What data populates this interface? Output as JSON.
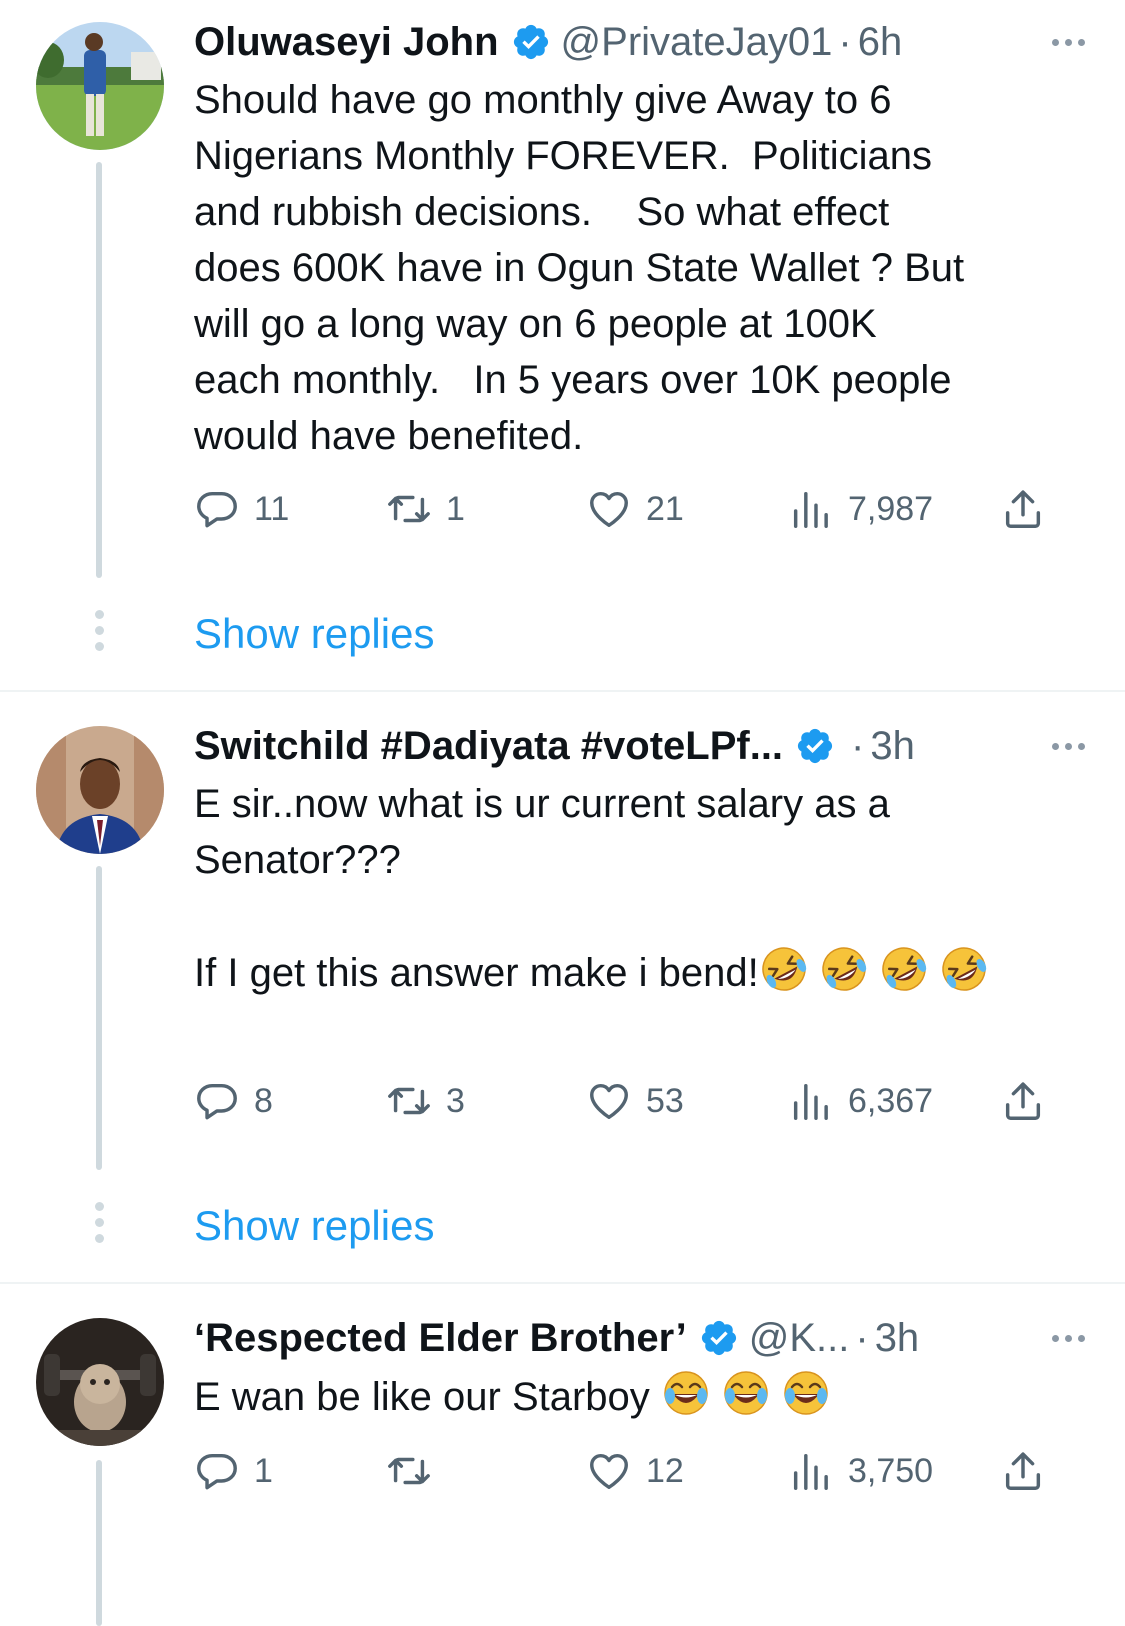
{
  "tweets": [
    {
      "name": "Oluwaseyi John",
      "handle": "@PrivateJay01",
      "dot": "·",
      "time": "6h",
      "text": "Should have go monthly give Away to 6\nNigerians Monthly FOREVER.  Politicians\nand rubbish decisions.    So what effect\ndoes 600K have in Ogun State Wallet ? But\nwill go a long way on 6 people at 100K\neach monthly.   In 5 years over 10K people\nwould have benefited.",
      "replies": "11",
      "retweets": "1",
      "likes": "21",
      "views": "7,987",
      "show_replies": "Show replies"
    },
    {
      "name": "Switchild #Dadiyata #voteLPf...",
      "handle": "",
      "dot": "·",
      "time": "3h",
      "text": "E sir..now what is ur current salary as a\nSenator???\n\nIf I get this answer make i bend!",
      "emoji_trailing": [
        "rolling-on-floor-laughing",
        "rolling-on-floor-laughing",
        "rolling-on-floor-laughing",
        "rolling-on-floor-laughing"
      ],
      "replies": "8",
      "retweets": "3",
      "likes": "53",
      "views": "6,367",
      "show_replies": "Show replies"
    },
    {
      "name": "‘Respected Elder Brother’",
      "handle": "@K...",
      "dot": "·",
      "time": "3h",
      "text": "E wan be like our Starboy ",
      "emoji_trailing": [
        "face-with-tears-of-joy",
        "face-with-tears-of-joy",
        "face-with-tears-of-joy"
      ],
      "replies": "1",
      "retweets": "",
      "likes": "12",
      "views": "3,750"
    }
  ],
  "colors": {
    "text": "#0f1419",
    "secondary": "#536471",
    "link": "#1d9bf0",
    "verified": "#1d9bf0",
    "thread": "#cfd9de"
  }
}
